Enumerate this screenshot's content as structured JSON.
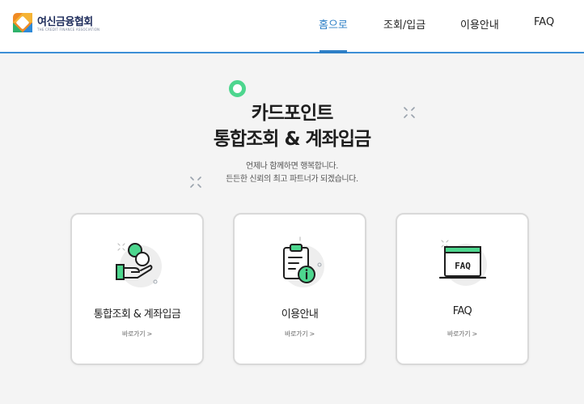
{
  "header": {
    "logo_title": "여신금융협회",
    "logo_subtitle": "THE CREDIT FINANCE ASSOCIATION",
    "nav": [
      {
        "label": "홈으로",
        "active": true
      },
      {
        "label": "조회/입금",
        "active": false
      },
      {
        "label": "이용안내",
        "active": false
      },
      {
        "label": "FAQ",
        "active": false
      }
    ]
  },
  "hero": {
    "title_line1": "카드포인트",
    "title_line2": "통합조회 & 계좌입금",
    "subtitle_line1": "언제나 함께하면 행복합니다.",
    "subtitle_line2": "든든한 신뢰의 최고 파트너가 되겠습니다."
  },
  "cards": [
    {
      "title": "통합조회 & 계좌입금",
      "link": "바로가기 >",
      "icon": "coin-hand-icon"
    },
    {
      "title": "이용안내",
      "link": "바로가기 >",
      "icon": "clipboard-info-icon"
    },
    {
      "title": "FAQ",
      "link": "바로가기 >",
      "icon": "faq-board-icon",
      "icon_text": "FAQ"
    }
  ],
  "colors": {
    "accent": "#2d7fc6",
    "green": "#4dd68e",
    "text": "#222222",
    "background": "#f4f4f4"
  }
}
